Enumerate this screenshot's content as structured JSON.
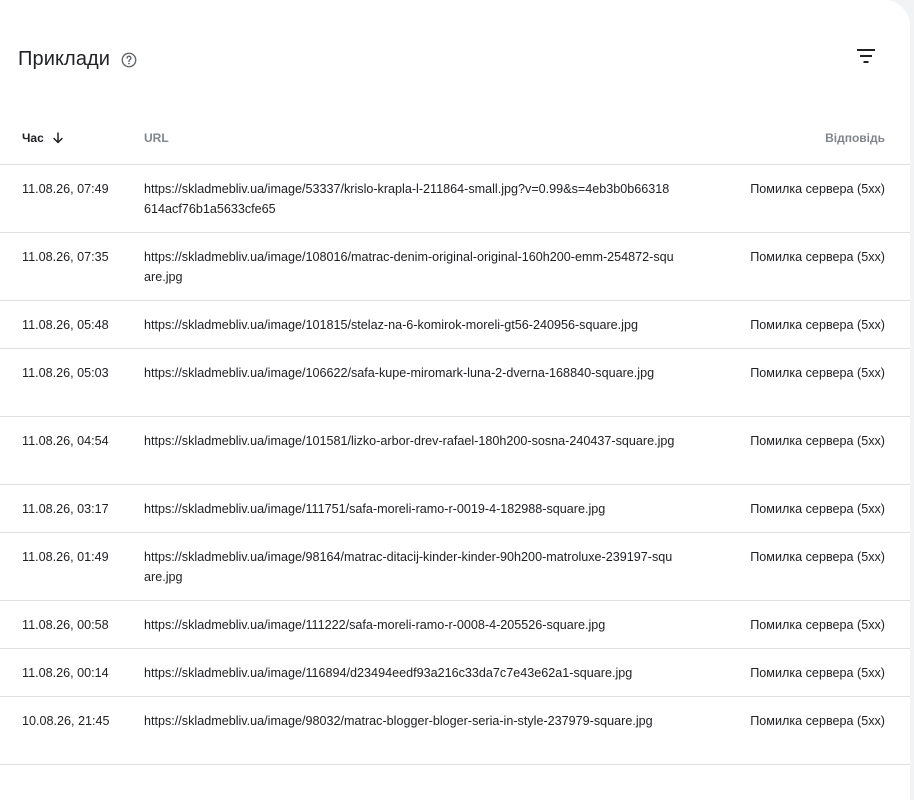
{
  "card": {
    "title": "Приклади"
  },
  "icons": {
    "help": "help-circle-icon",
    "filter": "filter-icon",
    "sort": "arrow-down-icon"
  },
  "table": {
    "headers": {
      "time": "Час",
      "url": "URL",
      "response": "Відповідь"
    },
    "rows": [
      {
        "time": "11.08.26, 07:49",
        "url": "https://skladmebliv.ua/image/53337/krislo-krapla-l-211864-small.jpg?v=0.99&s=4eb3b0b66318614acf76b1a5633cfe65",
        "response": "Помилка сервера (5xx)",
        "lines": 2
      },
      {
        "time": "11.08.26, 07:35",
        "url": "https://skladmebliv.ua/image/108016/matrac-denim-original-original-160h200-emm-254872-square.jpg",
        "response": "Помилка сервера (5xx)",
        "lines": 2
      },
      {
        "time": "11.08.26, 05:48",
        "url": "https://skladmebliv.ua/image/101815/stelaz-na-6-komirok-moreli-gt56-240956-square.jpg",
        "response": "Помилка сервера (5xx)",
        "lines": 1
      },
      {
        "time": "11.08.26, 05:03",
        "url": "https://skladmebliv.ua/image/106622/safa-kupe-miromark-luna-2-dverna-168840-square.jpg",
        "response": "Помилка сервера (5xx)",
        "lines": 2
      },
      {
        "time": "11.08.26, 04:54",
        "url": "https://skladmebliv.ua/image/101581/lizko-arbor-drev-rafael-180h200-sosna-240437-square.jpg",
        "response": "Помилка сервера (5xx)",
        "lines": 2
      },
      {
        "time": "11.08.26, 03:17",
        "url": "https://skladmebliv.ua/image/111751/safa-moreli-ramo-r-0019-4-182988-square.jpg",
        "response": "Помилка сервера (5xx)",
        "lines": 1
      },
      {
        "time": "11.08.26, 01:49",
        "url": "https://skladmebliv.ua/image/98164/matrac-ditacij-kinder-kinder-90h200-matroluxe-239197-square.jpg",
        "response": "Помилка сервера (5xx)",
        "lines": 2
      },
      {
        "time": "11.08.26, 00:58",
        "url": "https://skladmebliv.ua/image/111222/safa-moreli-ramo-r-0008-4-205526-square.jpg",
        "response": "Помилка сервера (5xx)",
        "lines": 1
      },
      {
        "time": "11.08.26, 00:14",
        "url": "https://skladmebliv.ua/image/116894/d23494eedf93a216c33da7c7e43e62a1-square.jpg",
        "response": "Помилка сервера (5xx)",
        "lines": 1
      },
      {
        "time": "10.08.26, 21:45",
        "url": "https://skladmebliv.ua/image/98032/matrac-blogger-bloger-seria-in-style-237979-square.jpg",
        "response": "Помилка сервера (5xx)",
        "lines": 2
      }
    ]
  }
}
